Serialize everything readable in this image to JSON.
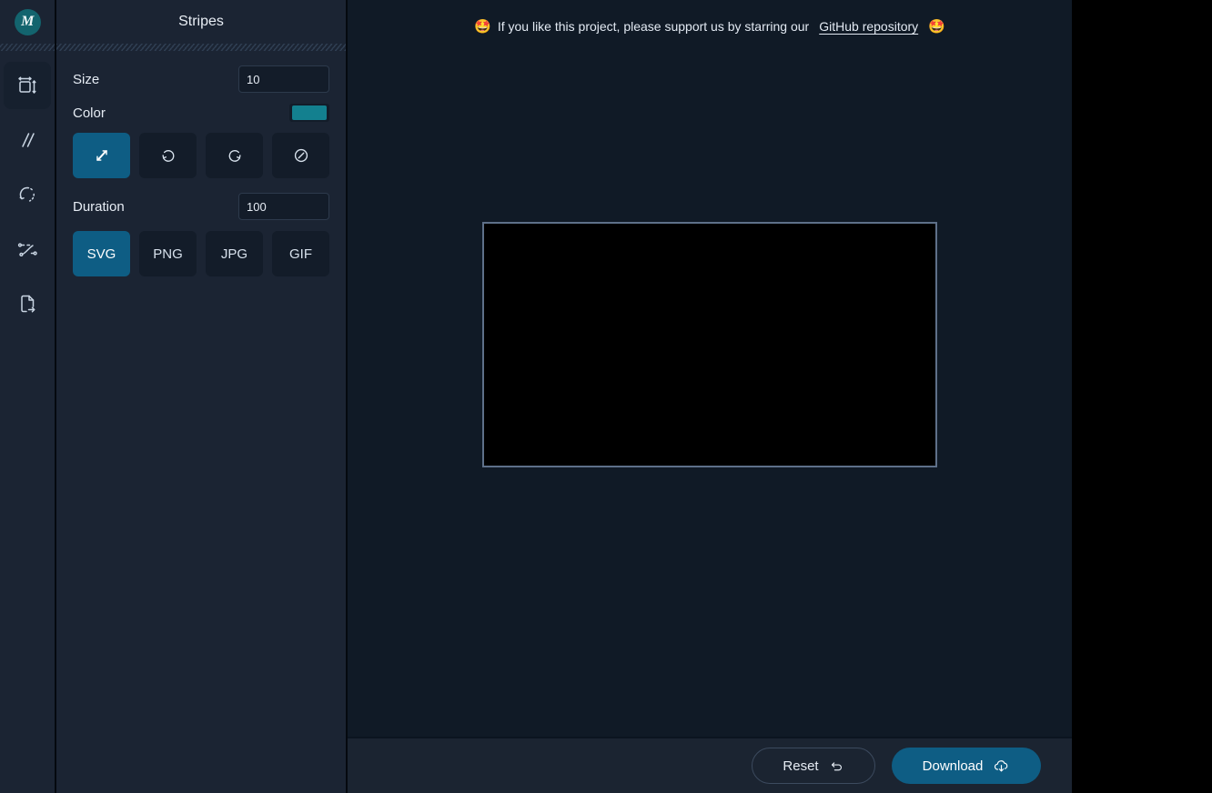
{
  "app": {
    "logo_text": "M",
    "background": "#101a26",
    "accent": "#0e5d84"
  },
  "rail": {
    "items": [
      {
        "icon": "resize-icon",
        "name": "size",
        "active": true
      },
      {
        "icon": "stripes-icon",
        "name": "stripes",
        "active": false
      },
      {
        "icon": "rotate-dashed-icon",
        "name": "rotation",
        "active": false
      },
      {
        "icon": "easing-curve-icon",
        "name": "easing",
        "active": false
      },
      {
        "icon": "file-export-icon",
        "name": "export",
        "active": false
      }
    ]
  },
  "panel": {
    "title": "Stripes",
    "size": {
      "label": "Size",
      "value": "10"
    },
    "color": {
      "label": "Color",
      "value": "#13808f"
    },
    "direction_buttons": [
      {
        "icon": "diagonal-arrows-icon",
        "name": "alternate",
        "active": true
      },
      {
        "icon": "rotate-ccw-icon",
        "name": "reverse",
        "active": false
      },
      {
        "icon": "rotate-cw-icon",
        "name": "forward",
        "active": false
      },
      {
        "icon": "circle-slash-icon",
        "name": "none",
        "active": false
      }
    ],
    "duration": {
      "label": "Duration",
      "value": "100"
    },
    "format_buttons": [
      {
        "label": "SVG",
        "active": true
      },
      {
        "label": "PNG",
        "active": false
      },
      {
        "label": "JPG",
        "active": false
      },
      {
        "label": "GIF",
        "active": false
      }
    ]
  },
  "banner": {
    "emoji_left": "🤩",
    "text_before": "If you like this project, please support us by starring our",
    "link_text": "GitHub repository",
    "emoji_right": "🤩"
  },
  "canvas": {
    "fill_color": "#000000",
    "border_color": "#5e7089"
  },
  "footer": {
    "reset_label": "Reset",
    "download_label": "Download"
  }
}
